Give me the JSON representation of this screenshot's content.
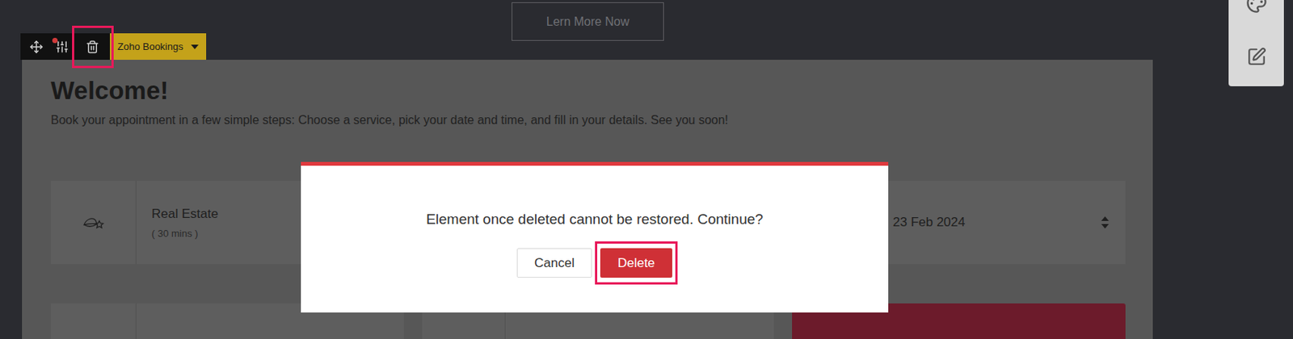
{
  "page_button": "Lern More Now",
  "toolbar": {
    "notification": true,
    "delete_highlighted": true,
    "element_label": "Zoho Bookings"
  },
  "card": {
    "title": "Welcome!",
    "subtitle": "Book your appointment in a few simple steps: Choose a service, pick your date and time, and fill in your details. See you soon!",
    "service": {
      "name": "Real Estate",
      "duration": "( 30 mins )"
    },
    "date": "23 Feb 2024"
  },
  "dialog": {
    "message": "Element once deleted cannot be restored. Continue?",
    "buttons": [
      {
        "label": "Cancel",
        "kind": "secondary",
        "highlighted": false
      },
      {
        "label": "Delete",
        "kind": "danger",
        "highlighted": true
      }
    ]
  }
}
